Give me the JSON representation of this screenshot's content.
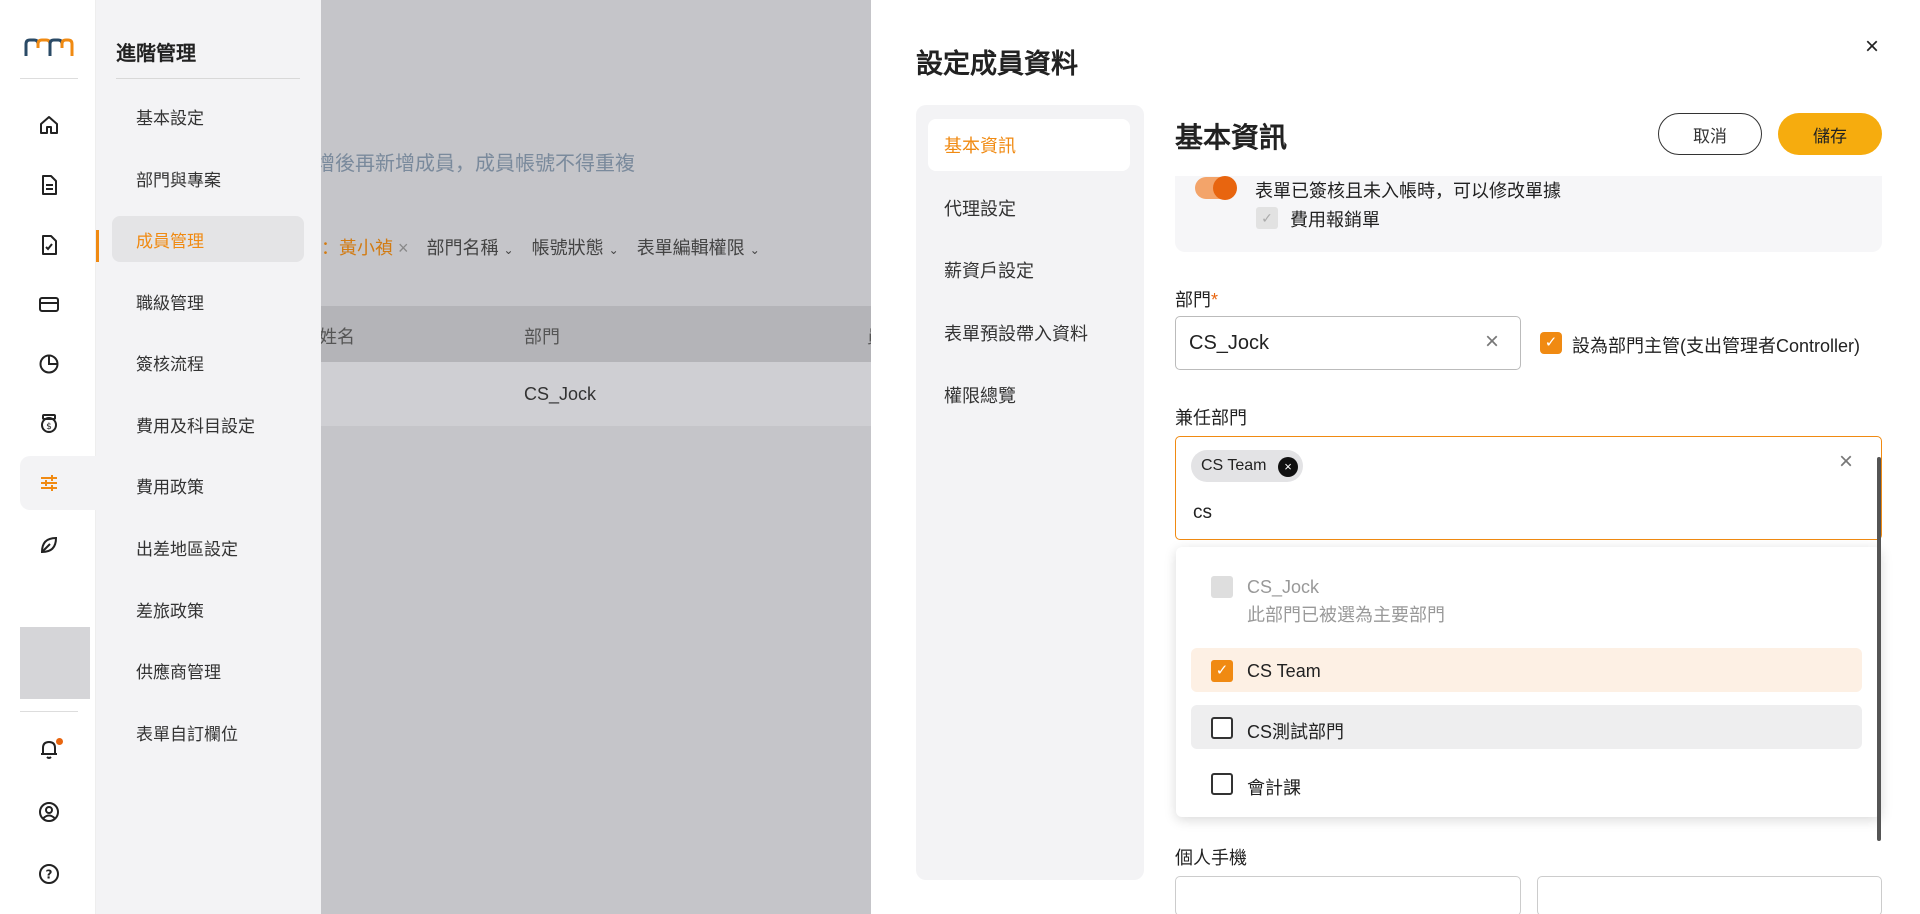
{
  "rail": {
    "icons": [
      "home-icon",
      "document-icon",
      "approval-icon",
      "card-icon",
      "pie-chart-icon",
      "expense-icon",
      "settings-sliders-icon",
      "leaf-icon",
      "bell-icon",
      "user-icon",
      "help-icon"
    ]
  },
  "subnav": {
    "title": "進階管理",
    "items": [
      "基本設定",
      "部門與專案",
      "成員管理",
      "職級管理",
      "簽核流程",
      "費用及科目設定",
      "費用政策",
      "出差地區設定",
      "差旅政策",
      "供應商管理",
      "表單自訂欄位"
    ],
    "active_index": 2
  },
  "background_page": {
    "hint": "增後再新增成員，成員帳號不得重複",
    "filter_active": "：黃小禎",
    "filter_remove": "×",
    "filters": [
      "部門名稱",
      "帳號狀態",
      "表單編輯權限"
    ],
    "columns": [
      "姓名",
      "部門",
      "員"
    ],
    "row_department": "CS_Jock"
  },
  "drawer": {
    "title": "設定成員資料",
    "close": "×",
    "nav": [
      "基本資訊",
      "代理設定",
      "薪資戶設定",
      "表單預設帶入資料",
      "權限總覽"
    ],
    "nav_active_index": 0,
    "section_title": "基本資訊",
    "cancel_label": "取消",
    "save_label": "儲存",
    "permission_text": "表單已簽核且未入帳時，可以修改單據",
    "permission_checkbox_label": "費用報銷單",
    "department_label": "部門",
    "required_mark": "*",
    "department_value": "CS_Jock",
    "manager_label": "設為部門主管(支出管理者Controller)",
    "concurrent_label": "兼任部門",
    "chip_label": "CS Team",
    "search_text": "cs",
    "options": [
      {
        "label": "CS_Jock",
        "note": "此部門已被選為主要部門",
        "state": "disabled"
      },
      {
        "label": "CS Team",
        "state": "checked"
      },
      {
        "label": "CS測試部門",
        "state": "hover"
      },
      {
        "label": "會計課",
        "state": "unchecked"
      }
    ],
    "mobile_label": "個人手機"
  },
  "colors": {
    "accent": "#f08a12",
    "save_button": "#f6ac0e",
    "overlay": "#c5c5c9"
  }
}
